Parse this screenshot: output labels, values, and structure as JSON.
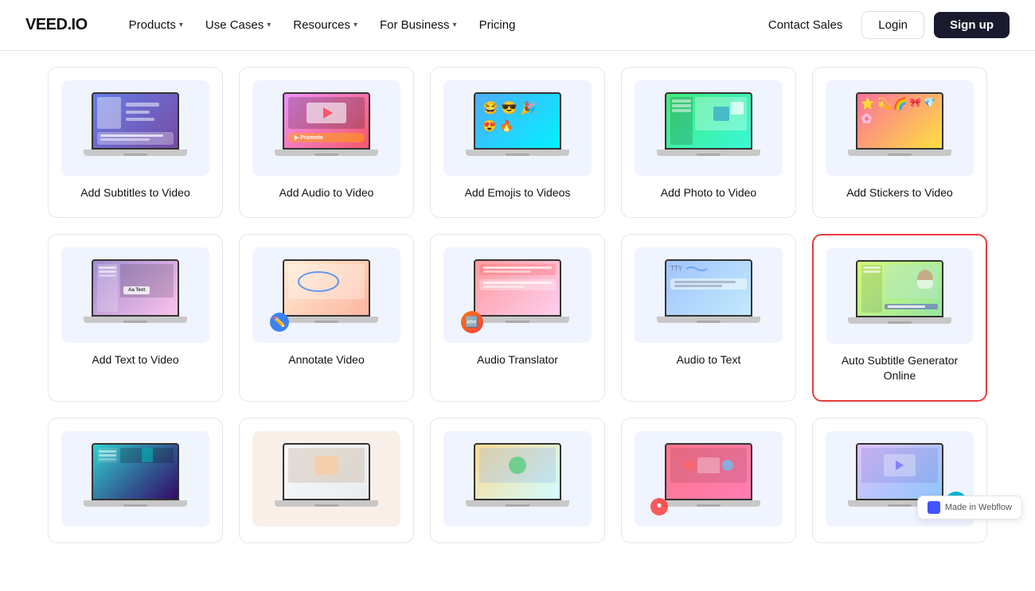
{
  "logo": "VEED.IO",
  "nav": {
    "items": [
      {
        "label": "Products",
        "hasChevron": true
      },
      {
        "label": "Use Cases",
        "hasChevron": true
      },
      {
        "label": "Resources",
        "hasChevron": true
      },
      {
        "label": "For Business",
        "hasChevron": true
      },
      {
        "label": "Pricing",
        "hasChevron": false
      }
    ],
    "right": {
      "contactSales": "Contact Sales",
      "login": "Login",
      "signup": "Sign up"
    }
  },
  "row1": [
    {
      "label": "Add Subtitles to Video",
      "screen": "subtitles"
    },
    {
      "label": "Add Audio to Video",
      "screen": "audio"
    },
    {
      "label": "Add Emojis to Videos",
      "screen": "emojis"
    },
    {
      "label": "Add Photo to Video",
      "screen": "photo"
    },
    {
      "label": "Add Stickers to Video",
      "screen": "stickers"
    }
  ],
  "row2": [
    {
      "label": "Add Text to Video",
      "screen": "text"
    },
    {
      "label": "Annotate Video",
      "screen": "annotate"
    },
    {
      "label": "Audio Translator",
      "screen": "translator"
    },
    {
      "label": "Audio to Text",
      "screen": "a2t"
    },
    {
      "label": "Auto Subtitle Generator Online",
      "screen": "autosubtitle",
      "highlighted": true
    }
  ],
  "row3": [
    {
      "label": "",
      "screen": "row3-1"
    },
    {
      "label": "",
      "screen": "row3-2"
    },
    {
      "label": "",
      "screen": "row3-3"
    },
    {
      "label": "",
      "screen": "row3-4"
    },
    {
      "label": "",
      "screen": "row3-5"
    }
  ],
  "webflow": "Made in Webflow"
}
